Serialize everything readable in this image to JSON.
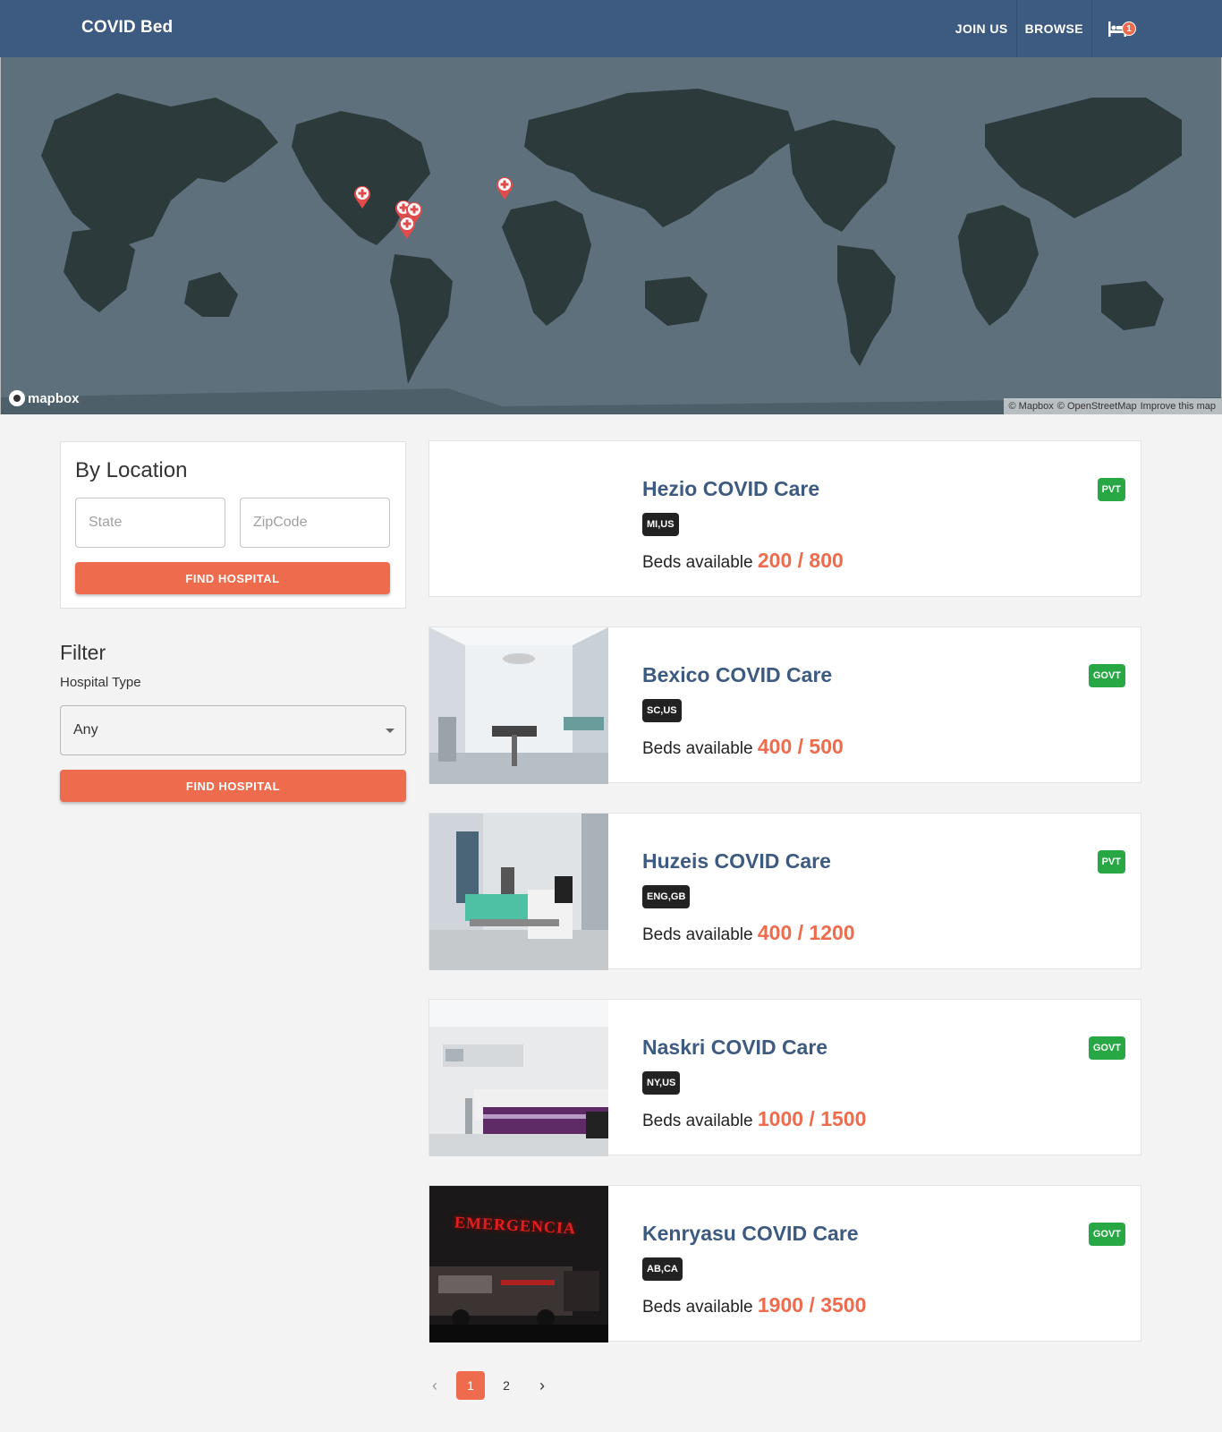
{
  "header": {
    "brand": "COVID Bed",
    "nav": [
      "JOIN US",
      "BROWSE"
    ],
    "bed_badge": "1"
  },
  "map": {
    "logo_text": "mapbox",
    "attribution": [
      "© Mapbox",
      "© OpenStreetMap",
      "Improve this map"
    ]
  },
  "search": {
    "title": "By Location",
    "state_placeholder": "State",
    "zip_placeholder": "ZipCode",
    "button": "FIND HOSPITAL"
  },
  "filter": {
    "title": "Filter",
    "label": "Hospital Type",
    "selected": "Any",
    "button": "FIND HOSPITAL"
  },
  "hospitals": [
    {
      "name": "Hezio COVID Care",
      "location": "MI,US",
      "beds_label": "Beds available",
      "beds": "200 / 800",
      "type": "PVT",
      "image": "none"
    },
    {
      "name": "Bexico COVID Care",
      "location": "SC,US",
      "beds_label": "Beds available",
      "beds": "400 / 500",
      "type": "GOVT",
      "image": "operating-room"
    },
    {
      "name": "Huzeis COVID Care",
      "location": "ENG,GB",
      "beds_label": "Beds available",
      "beds": "400 / 1200",
      "type": "PVT",
      "image": "hospital-bed-green"
    },
    {
      "name": "Naskri COVID Care",
      "location": "NY,US",
      "beds_label": "Beds available",
      "beds": "1000 / 1500",
      "type": "GOVT",
      "image": "hospital-bed-purple"
    },
    {
      "name": "Kenryasu COVID Care",
      "location": "AB,CA",
      "beds_label": "Beds available",
      "beds": "1900 / 3500",
      "type": "GOVT",
      "image": "emergencia"
    }
  ],
  "emergency_sign": "EMERGENCIA",
  "pagination": {
    "pages": [
      "1",
      "2"
    ],
    "current": "1"
  },
  "colors": {
    "primary": "#3d5a80",
    "accent": "#ee6c4d",
    "govt_badge": "#28a745"
  }
}
